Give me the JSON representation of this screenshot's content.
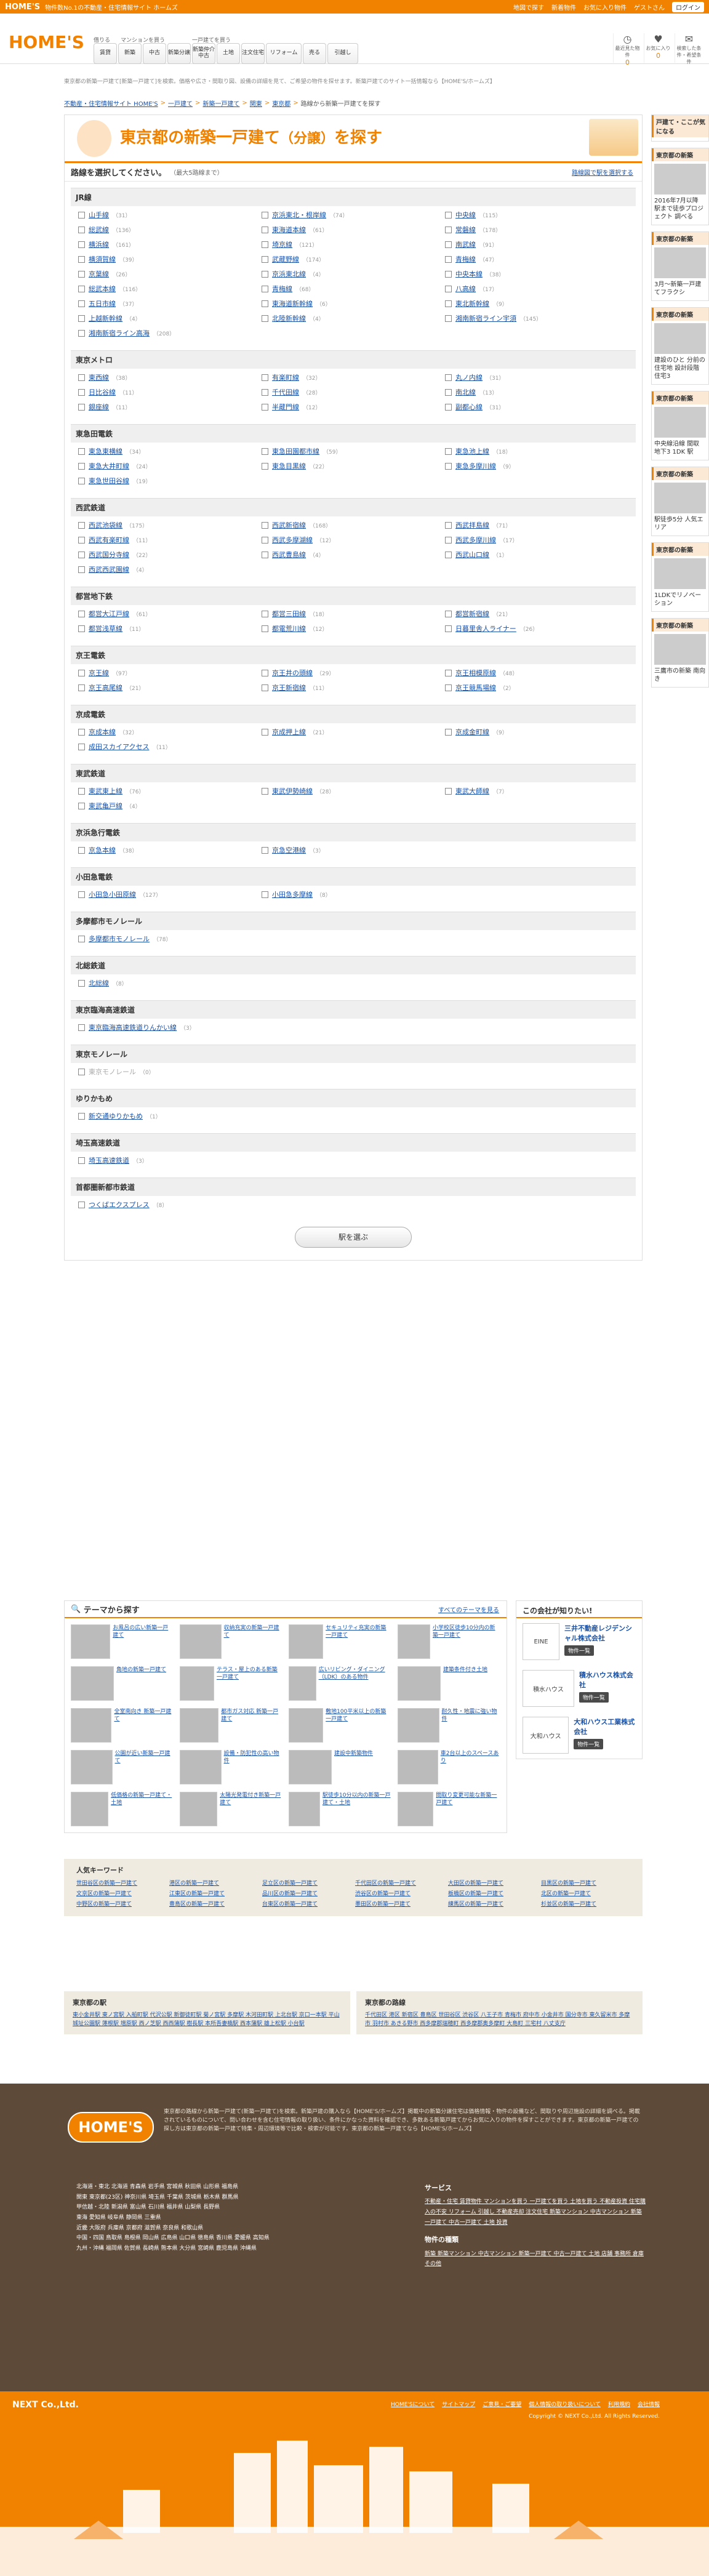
{
  "topbar": {
    "logo": "HOME'S",
    "tagline": "物件数No.1の不動産・住宅情報サイト ホームズ",
    "links": [
      "地図で探す",
      "新着物件",
      "お気に入り物件",
      "ゲストさん"
    ],
    "login": "ログイン"
  },
  "header": {
    "logo": "HOME'S",
    "nav_sub1": "借りる",
    "nav_sub2": "マンションを買う",
    "nav_sub3": "一戸建てを買う",
    "nav": [
      "賃貸",
      "新築",
      "中古",
      "新築分譲",
      "新築仲介中古",
      "土地",
      "注文住宅",
      "リフォーム",
      "売る",
      "引越し"
    ],
    "icons": [
      {
        "name": "history-icon",
        "label": "最近見た物件",
        "count": "0"
      },
      {
        "name": "favorite-icon",
        "label": "お気に入り",
        "count": "0"
      },
      {
        "name": "search-save-icon",
        "label": "検索した条件・希望条件",
        "count": ""
      }
    ]
  },
  "description": "東京都の新築一戸建て[新築一戸建て]を検索。価格や広さ・間取り図、設備の詳細を見て、ご希望の物件を探せます。新築戸建てのサイト一括情報なら【HOME'S/ホームズ】",
  "breadcrumb": [
    "不動産・住宅情報サイト HOME'S",
    "一戸建て",
    "新築一戸建て",
    "関東",
    "東京都",
    "路線から新築一戸建てを探す"
  ],
  "main": {
    "title_pre": "東京都の",
    "title_main": "新築一戸建て",
    "title_suf": "（分譲）",
    "title_end": "を探す",
    "select_title": "路線を選択してください。",
    "select_note": "（最大5路線まで）",
    "select_link": "路線図で駅を選択する",
    "groups": [
      {
        "name": "JR線",
        "lines": [
          [
            "山手線",
            "31"
          ],
          [
            "京浜東北・根岸線",
            "74"
          ],
          [
            "中央線",
            "115"
          ],
          [
            "総武線",
            "136"
          ],
          [
            "東海道本線",
            "61"
          ],
          [
            "常磐線",
            "178"
          ],
          [
            "横浜線",
            "161"
          ],
          [
            "埼京線",
            "121"
          ],
          [
            "南武線",
            "91"
          ],
          [
            "横須賀線",
            "39"
          ],
          [
            "武蔵野線",
            "174"
          ],
          [
            "青梅線",
            "47"
          ],
          [
            "京葉線",
            "26"
          ],
          [
            "京浜東北線",
            "4"
          ],
          [
            "中央本線",
            "38"
          ],
          [
            "総武本線",
            "116"
          ],
          [
            "青梅線",
            "68"
          ],
          [
            "八高線",
            "17"
          ],
          [
            "五日市線",
            "37"
          ],
          [
            "東海道新幹線",
            "6"
          ],
          [
            "東北新幹線",
            "9"
          ],
          [
            "上越新幹線",
            "4"
          ],
          [
            "北陸新幹線",
            "4"
          ],
          [
            "湘南新宿ライン宇須",
            "145"
          ],
          [
            "湘南新宿ライン高海",
            "208"
          ]
        ]
      },
      {
        "name": "東京メトロ",
        "lines": [
          [
            "東西線",
            "38"
          ],
          [
            "有楽町線",
            "32"
          ],
          [
            "丸ノ内線",
            "31"
          ],
          [
            "日比谷線",
            "11"
          ],
          [
            "千代田線",
            "28"
          ],
          [
            "南北線",
            "13"
          ],
          [
            "銀座線",
            "11"
          ],
          [
            "半蔵門線",
            "12"
          ],
          [
            "副都心線",
            "31"
          ]
        ]
      },
      {
        "name": "東急田電鉄",
        "lines": [
          [
            "東急東横線",
            "34"
          ],
          [
            "東急田園都市線",
            "59"
          ],
          [
            "東急池上線",
            "18"
          ],
          [
            "東急大井町線",
            "24"
          ],
          [
            "東急目黒線",
            "22"
          ],
          [
            "東急多摩川線",
            "9"
          ],
          [
            "東急世田谷線",
            "19"
          ]
        ]
      },
      {
        "name": "西武鉄道",
        "lines": [
          [
            "西武池袋線",
            "175"
          ],
          [
            "西武新宿線",
            "168"
          ],
          [
            "西武拝島線",
            "71"
          ],
          [
            "西武有楽町線",
            "11"
          ],
          [
            "西武多摩湖線",
            "12"
          ],
          [
            "西武多摩川線",
            "17"
          ],
          [
            "西武国分寺線",
            "22"
          ],
          [
            "西武豊島線",
            "4"
          ],
          [
            "西武山口線",
            "1"
          ],
          [
            "西武西武園線",
            "4"
          ]
        ]
      },
      {
        "name": "都営地下鉄",
        "lines": [
          [
            "都営大江戸線",
            "61"
          ],
          [
            "都営三田線",
            "18"
          ],
          [
            "都営新宿線",
            "21"
          ],
          [
            "都営浅草線",
            "11"
          ],
          [
            "都電荒川線",
            "12"
          ],
          [
            "日暮里舎人ライナー",
            "26"
          ]
        ]
      },
      {
        "name": "京王電鉄",
        "lines": [
          [
            "京王線",
            "97"
          ],
          [
            "京王井の頭線",
            "29"
          ],
          [
            "京王相模原線",
            "48"
          ],
          [
            "京王高尾線",
            "21"
          ],
          [
            "京王新宿線",
            "11"
          ],
          [
            "京王競馬場線",
            "2"
          ]
        ]
      },
      {
        "name": "京成電鉄",
        "lines": [
          [
            "京成本線",
            "32"
          ],
          [
            "京成押上線",
            "21"
          ],
          [
            "京成金町線",
            "9"
          ],
          [
            "成田スカイアクセス",
            "11"
          ]
        ]
      },
      {
        "name": "東武鉄道",
        "lines": [
          [
            "東武東上線",
            "76"
          ],
          [
            "東武伊勢崎線",
            "28"
          ],
          [
            "東武大師線",
            "7"
          ],
          [
            "東武亀戸線",
            "4"
          ]
        ]
      },
      {
        "name": "京浜急行電鉄",
        "lines": [
          [
            "京急本線",
            "38"
          ],
          [
            "京急空港線",
            "3"
          ]
        ]
      },
      {
        "name": "小田急電鉄",
        "lines": [
          [
            "小田急小田原線",
            "127"
          ],
          [
            "小田急多摩線",
            "8"
          ]
        ]
      },
      {
        "name": "多摩都市モノレール",
        "lines": [
          [
            "多摩都市モノレール",
            "78"
          ]
        ]
      },
      {
        "name": "北総鉄道",
        "lines": [
          [
            "北総線",
            "8"
          ]
        ]
      },
      {
        "name": "東京臨海高速鉄道",
        "lines": [
          [
            "東京臨海高速鉄道りんかい線",
            "3"
          ]
        ]
      },
      {
        "name": "東京モノレール",
        "lines": [
          [
            "東京モノレール",
            "0"
          ]
        ]
      },
      {
        "name": "ゆりかもめ",
        "lines": [
          [
            "新交通ゆりかもめ",
            "1"
          ]
        ]
      },
      {
        "name": "埼玉高速鉄道",
        "lines": [
          [
            "埼玉高速鉄道",
            "3"
          ]
        ]
      },
      {
        "name": "首都圏新都市鉄道",
        "lines": [
          [
            "つくばエクスプレス",
            "8"
          ]
        ]
      }
    ],
    "next_button": "駅を選ぶ"
  },
  "sidebar": {
    "boxes": [
      {
        "title": "戸建て・ここが気になる",
        "text": ""
      },
      {
        "title": "東京都の新築",
        "text": "2016年7月以降 駅まで徒歩プロジェクト 調べる"
      },
      {
        "title": "東京都の新築",
        "text": "3月～新築一戸建てフラクシ"
      },
      {
        "title": "東京都の新築",
        "text": "建設のひと 分前の住宅地 設計段階 住宅3"
      },
      {
        "title": "東京都の新築",
        "text": "中央線沿線 間取 地下3 1DK 駅"
      },
      {
        "title": "東京都の新築",
        "text": "駅徒歩5分 人気エリア"
      },
      {
        "title": "東京都の新築",
        "text": "1LDKでリノベーション"
      },
      {
        "title": "東京都の新築",
        "text": "三鷹市の新築 南向き"
      }
    ]
  },
  "theme": {
    "title": "テーマから探す",
    "link": "すべてのテーマを見る",
    "items": [
      "お風呂の広い新築一戸建て",
      "収納充実の新築一戸建て",
      "セキュリティ充実の新築一戸建て",
      "小学校区徒歩10分内の新築一戸建て",
      "角地の新築一戸建て",
      "テラス・屋上のある新築一戸建て",
      "広いリビング・ダイニング（LDK）のある物件",
      "建築条件付き土地",
      "全室南向き 新築一戸建て",
      "都市ガス対応 新築一戸建て",
      "敷地100平米以上の新築一戸建て",
      "耐久性・地震に強い物件",
      "公園が近い新築一戸建て",
      "設備・防犯性の高い物件",
      "建設中新築物件",
      "車2台以上のスペースあり",
      "低価格の新築一戸建て・土地",
      "太陽光発電付き新築一戸建て",
      "駅徒歩10分以内の新築一戸建て・土地",
      "間取り変更可能な新築一戸建て"
    ]
  },
  "company": {
    "title": "この会社が知りたい!",
    "items": [
      {
        "logo": "EINE",
        "name": "三井不動産レジデンシャル株式会社",
        "btn": "物件一覧"
      },
      {
        "logo": "積水ハウス",
        "name": "積水ハウス株式会社",
        "btn": "物件一覧"
      },
      {
        "logo": "大和ハウス",
        "name": "大和ハウス工業株式会社",
        "btn": "物件一覧"
      }
    ]
  },
  "keywords": {
    "title": "人気キーワード",
    "items": [
      "世田谷区の新築一戸建て",
      "港区の新築一戸建て",
      "足立区の新築一戸建て",
      "千代田区の新築一戸建て",
      "大田区の新築一戸建て",
      "目黒区の新築一戸建て",
      "文京区の新築一戸建て",
      "江東区の新築一戸建て",
      "品川区の新築一戸建て",
      "渋谷区の新築一戸建て",
      "板橋区の新築一戸建て",
      "北区の新築一戸建て",
      "中野区の新築一戸建て",
      "豊島区の新築一戸建て",
      "台東区の新築一戸建て",
      "墨田区の新築一戸建て",
      "練馬区の新築一戸建て",
      "杉並区の新築一戸建て"
    ]
  },
  "areas": {
    "left_title": "東京都の駅",
    "left": "東小金井駅 東ノ宮駅 入船町駅 代沢公駅 新御徒町駅 菊ノ宮駅 多摩駅 木河田町駅 上北台駅 京口一本駅 平山城址公園駅 蓮根駅 増原駅 西ノ芝駅 西西蒲駅 樹長駅 本所吾妻橋駅 西本蒲駅 雄上松駅 小台駅",
    "right_title": "東京都の路線",
    "right": "千代田区 港区 新宿区 豊島区 世田谷区 渋谷区 八王子市 青梅市 府中市 小金井市 国分寺市 東久留米市 多摩市 羽村市 あきる野市 西多摩郡瑞穂町 西多摩郡奥多摩町 大島町 三宅村 八丈支庁"
  },
  "footer": {
    "logo": "HOME'S",
    "desc": "東京都の路線から新築一戸建て(新築一戸建て)を検索。新築戸建の購入なら【HOME'S/ホームズ】掲載中の新築分譲住宅は価格情報・物件の設備など、間取りや周辺施設の詳細を調べる。掲載されているものについて、問い合わせを含む住宅情報の取り扱い、条件にかなった資料を確認でき、多数ある新築戸建てからお気に入りの物件を探すことができます。東京都の新築一戸建ての探し方は東京都の新築一戸建て特集・周辺環境等で比較・検索が可能です。東京都の新築一戸建てなら【HOME'S/ホームズ】",
    "prefs": [
      "北海道・東北 北海道 青森県 岩手県 宮城県 秋田県 山形県 福島県",
      "関東 東京都(23区) 神奈川県 埼玉県 千葉県 茨城県 栃木県 群馬県",
      "甲信越・北陸 新潟県 富山県 石川県 福井県 山梨県 長野県",
      "東海 愛知県 岐阜県 静岡県 三重県",
      "近畿 大阪府 兵庫県 京都府 滋賀県 奈良県 和歌山県",
      "中国・四国 鳥取県 島根県 岡山県 広島県 山口県 徳島県 香川県 愛媛県 高知県",
      "九州・沖縄 福岡県 佐賀県 長崎県 熊本県 大分県 宮崎県 鹿児島県 沖縄県"
    ],
    "service_title": "サービス",
    "services": "不動産・住宅 賃貸物件 マンションを買う 一戸建てを買う 土地を買う 不動産投資 住宅購入の不安 リフォーム 引越し 不動産売却 注文住宅 新築マンション 中古マンション 新築一戸建て 中古一戸建て 土地 投資",
    "property_title": "物件の種類",
    "properties": "新築 新築マンション 中古マンション 新築一戸建て 中古一戸建て 土地 店舗 事務所 倉庫 その他",
    "bottom_links": [
      "HOME'Sについて",
      "サイトマップ",
      "ご意見・ご要望",
      "個人情報の取り扱いについて",
      "利用規約",
      "会社情報"
    ],
    "company": "NEXT Co.,Ltd.",
    "copyright": "Copyright © NEXT Co.,Ltd. All Rights Reserved."
  }
}
